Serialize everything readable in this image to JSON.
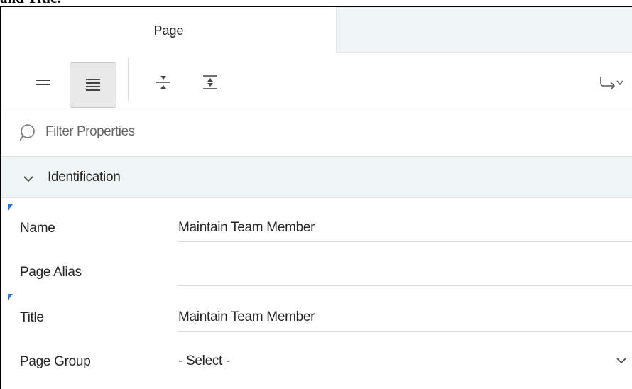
{
  "top_clip_text": "and Title.",
  "tabs": [
    {
      "label": "Page",
      "active": true
    },
    {
      "label": "",
      "active": false
    }
  ],
  "toolbar": {
    "buttons": [
      {
        "icon": "show-common-icon",
        "active": false
      },
      {
        "icon": "show-all-icon",
        "active": true
      },
      {
        "icon": "collapse-all-icon",
        "active": false
      },
      {
        "icon": "expand-all-icon",
        "active": false
      },
      {
        "icon": "go-to-group-icon",
        "active": false
      }
    ]
  },
  "filter": {
    "placeholder": "Filter Properties",
    "value": ""
  },
  "group": {
    "label": "Identification",
    "expanded": true,
    "header_color": "#eef5f4"
  },
  "properties": [
    {
      "label": "Name",
      "value": "Maintain Team Member",
      "required": true
    },
    {
      "label": "Page Alias",
      "value": "",
      "required": false
    },
    {
      "label": "Title",
      "value": "Maintain Team Member",
      "required": true
    },
    {
      "label": "Page Group",
      "value": "- Select -",
      "required": false,
      "type": "select"
    }
  ],
  "colors": {
    "required_marker": "#1a73e8",
    "tab_inactive_bg": "#eef5f4"
  }
}
